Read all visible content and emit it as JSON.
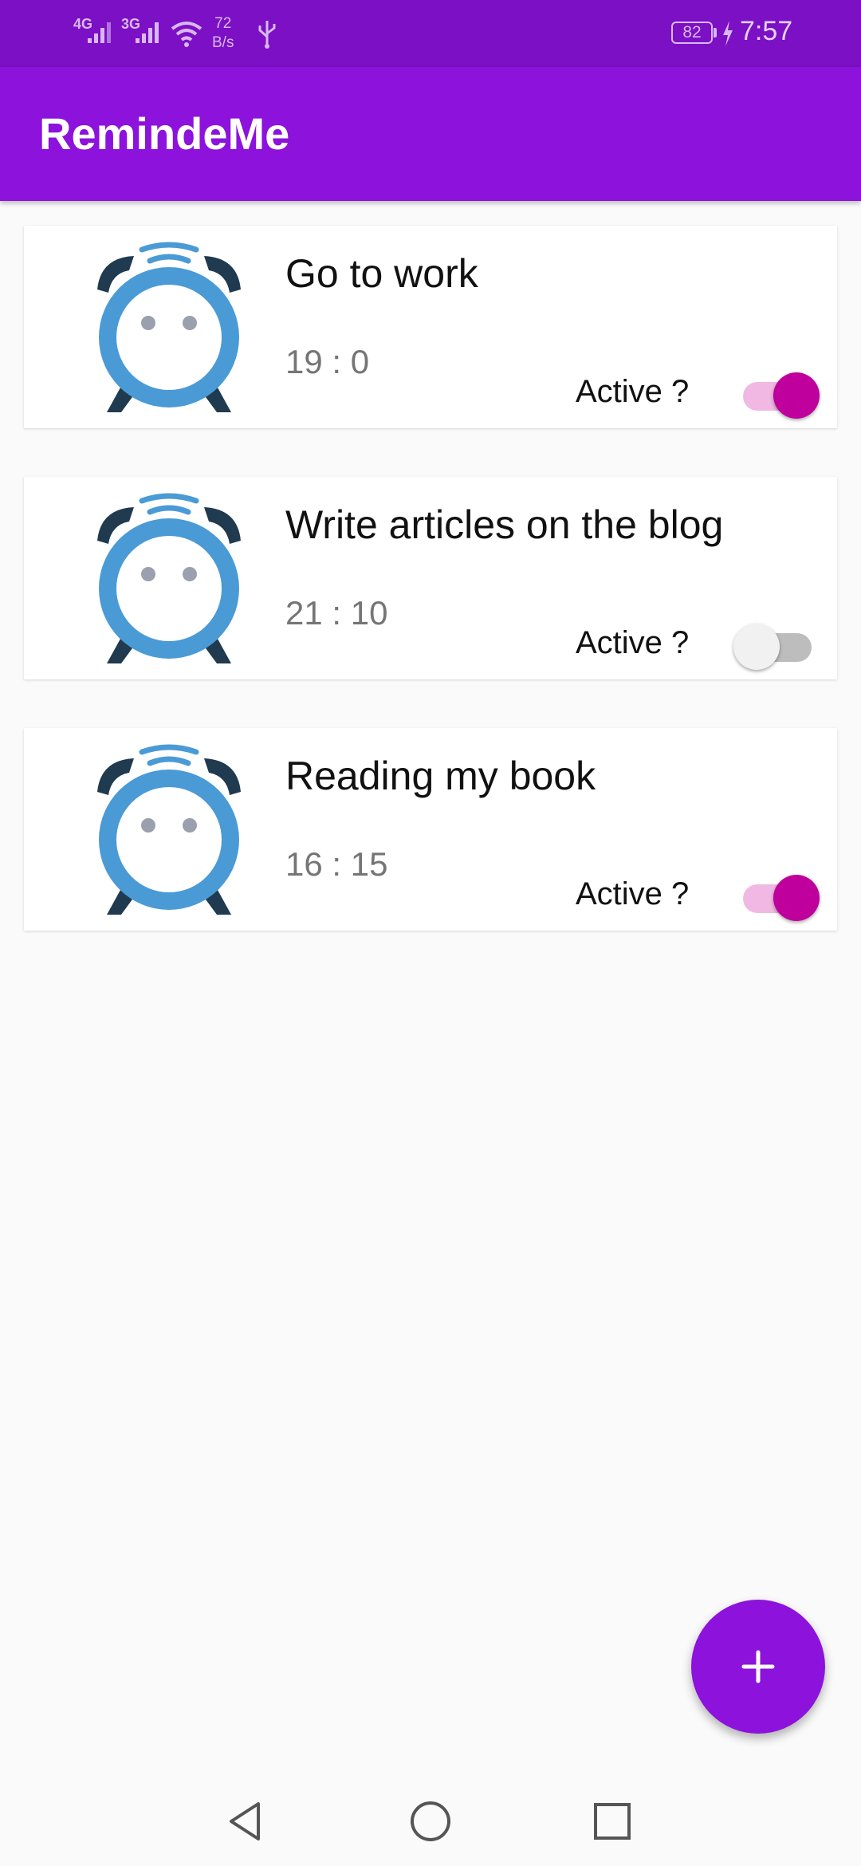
{
  "status_bar": {
    "network_1": "4G",
    "network_2": "3G",
    "speed_value": "72",
    "speed_unit": "B/s",
    "battery": "82",
    "time": "7:57"
  },
  "app_bar": {
    "title": "RemindeMe"
  },
  "reminders": [
    {
      "title": "Go to work",
      "time": "19 : 0",
      "active_label": "Active ?",
      "active": true
    },
    {
      "title": "Write articles on the blog",
      "time": "21 : 10",
      "active_label": "Active ?",
      "active": false
    },
    {
      "title": "Reading my book",
      "time": "16 : 15",
      "active_label": "Active ?",
      "active": true
    }
  ],
  "fab": {
    "icon": "plus-icon"
  },
  "nav_bar": {
    "back_icon": "back-triangle-icon",
    "home_icon": "home-circle-icon",
    "recents_icon": "recents-square-icon"
  },
  "colors": {
    "app_bar": "#8c12dc",
    "status_bar": "#7b10c4",
    "switch_on_thumb": "#c0009c",
    "switch_on_track": "#f0b8e2",
    "clock_body": "#4a9ad6",
    "clock_dark": "#203a4f"
  }
}
